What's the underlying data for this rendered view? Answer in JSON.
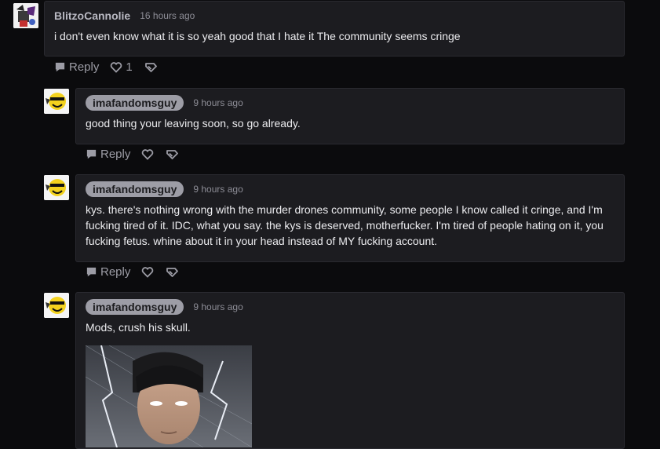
{
  "comments": [
    {
      "username": "BlitzoCannolie",
      "timestamp": "16 hours ago",
      "text": "i don't even know what it is so yeah good that I hate it The community seems cringe",
      "reply_label": "Reply",
      "like_count": "1"
    },
    {
      "username": "imafandomsguy",
      "timestamp": "9 hours ago",
      "text": "good thing your leaving soon, so go already.",
      "reply_label": "Reply"
    },
    {
      "username": "imafandomsguy",
      "timestamp": "9 hours ago",
      "text": "kys. there's nothing wrong with the murder drones community, some people I know called it cringe, and I'm fucking tired of it. IDC, what you say. the kys is deserved, motherfucker. I'm tired of people hating on it, you fucking fetus. whine about it in your head instead of MY fucking account.",
      "reply_label": "Reply"
    },
    {
      "username": "imafandomsguy",
      "timestamp": "9 hours ago",
      "text": "Mods, crush his skull."
    }
  ],
  "colors": {
    "background": "#0b0b0d",
    "card": "#1c1c20",
    "pill": "#9d9da6",
    "muted": "#8d8d96"
  },
  "icons": [
    "speech-bubble-icon",
    "heart-icon",
    "share-icon"
  ]
}
